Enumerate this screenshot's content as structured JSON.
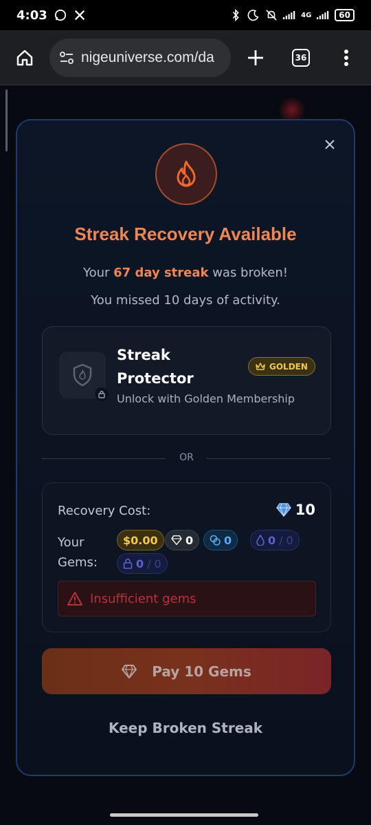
{
  "status_bar": {
    "time": "4:03",
    "battery": "60",
    "network": "4G"
  },
  "browser": {
    "url": "nigeuniverse.com/da",
    "tab_count": "36"
  },
  "modal": {
    "title": "Streak Recovery Available",
    "streak_prefix": "Your ",
    "streak_highlight": "67 day streak",
    "streak_suffix": " was broken!",
    "missed_text": "You missed 10 days of activity.",
    "protector": {
      "title": "Streak Protector",
      "subtitle": "Unlock with Golden Membership",
      "badge": "GOLDEN"
    },
    "or_label": "OR",
    "recovery": {
      "cost_label": "Recovery Cost:",
      "cost_value": "10",
      "gems_label": "Your Gems:",
      "usd_balance": "$0.00",
      "white_gems": "0",
      "blue_gems": "0",
      "purple_gems": "0",
      "purple_gems_max": "0",
      "locked_gems": "0",
      "locked_gems_max": "0",
      "error": "Insufficient gems"
    },
    "pay_button": "Pay 10 Gems",
    "keep_link": "Keep Broken Streak"
  },
  "colors": {
    "accent_orange": "#f08654",
    "gold": "#f2c94c",
    "error_red": "#b5343a",
    "modal_border": "#1d3a73"
  },
  "icons": [
    "home-icon",
    "site-settings-icon",
    "plus-icon",
    "tabs-icon",
    "more-icon",
    "close-icon",
    "flame-icon",
    "shield-icon",
    "lock-icon",
    "crown-icon",
    "diamond-icon",
    "warning-icon"
  ]
}
